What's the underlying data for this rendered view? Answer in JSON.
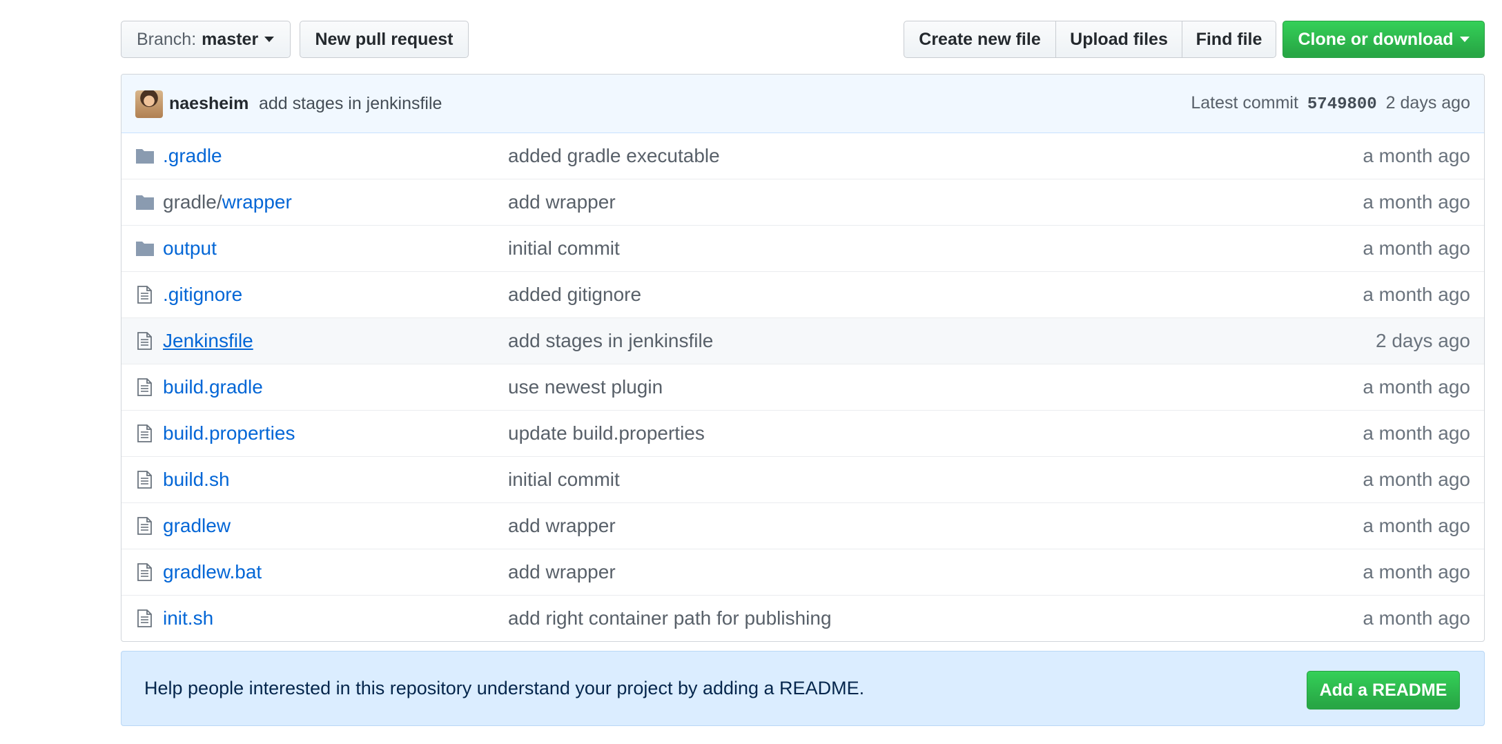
{
  "toolbar": {
    "branch_prefix": "Branch:",
    "branch_name": "master",
    "new_pull_request": "New pull request",
    "create_new_file": "Create new file",
    "upload_files": "Upload files",
    "find_file": "Find file",
    "clone_or_download": "Clone or download"
  },
  "commit": {
    "author": "naesheim",
    "message": "add stages in jenkinsfile",
    "latest_label": "Latest commit",
    "sha": "5749800",
    "age": "2 days ago"
  },
  "files": [
    {
      "name": ".gradle",
      "prefix": "",
      "type": "folder",
      "message": "added gradle executable",
      "age": "a month ago"
    },
    {
      "name": "wrapper",
      "prefix": "gradle/",
      "type": "folder",
      "message": "add wrapper",
      "age": "a month ago"
    },
    {
      "name": "output",
      "prefix": "",
      "type": "folder",
      "message": "initial commit",
      "age": "a month ago"
    },
    {
      "name": ".gitignore",
      "prefix": "",
      "type": "file",
      "message": "added gitignore",
      "age": "a month ago"
    },
    {
      "name": "Jenkinsfile",
      "prefix": "",
      "type": "file",
      "message": "add stages in jenkinsfile",
      "age": "2 days ago"
    },
    {
      "name": "build.gradle",
      "prefix": "",
      "type": "file",
      "message": "use newest plugin",
      "age": "a month ago"
    },
    {
      "name": "build.properties",
      "prefix": "",
      "type": "file",
      "message": "update build.properties",
      "age": "a month ago"
    },
    {
      "name": "build.sh",
      "prefix": "",
      "type": "file",
      "message": "initial commit",
      "age": "a month ago"
    },
    {
      "name": "gradlew",
      "prefix": "",
      "type": "file",
      "message": "add wrapper",
      "age": "a month ago"
    },
    {
      "name": "gradlew.bat",
      "prefix": "",
      "type": "file",
      "message": "add wrapper",
      "age": "a month ago"
    },
    {
      "name": "init.sh",
      "prefix": "",
      "type": "file",
      "message": "add right container path for publishing",
      "age": "a month ago"
    }
  ],
  "readme_banner": {
    "text": "Help people interested in this repository understand your project by adding a README.",
    "button": "Add a README"
  },
  "colors": {
    "link": "#0366d6",
    "primary_button": "#28a745",
    "commit_bar": "#f1f8ff",
    "readme_banner": "#dbedff"
  }
}
